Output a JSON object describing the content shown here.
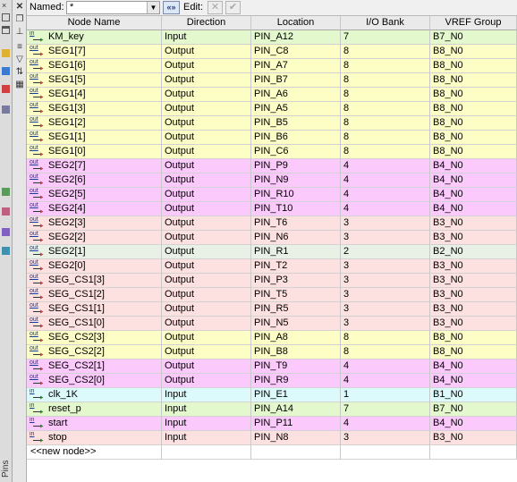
{
  "toolbar": {
    "named_label": "Named:",
    "named_value": "*",
    "expand_label": "«»",
    "edit_label": "Edit:",
    "cancel_glyph": "✕",
    "apply_glyph": "✔"
  },
  "side_tab": {
    "label": "Pins"
  },
  "table": {
    "columns": [
      "Node Name",
      "Direction",
      "Location",
      "I/O Bank",
      "VREF Group"
    ],
    "new_node_label": "<<new node>>",
    "rows": [
      {
        "name": "KM_key",
        "dir": "Input",
        "loc": "PIN_A12",
        "bank": "7",
        "vref": "B7_N0",
        "color": "green"
      },
      {
        "name": "SEG1[7]",
        "dir": "Output",
        "loc": "PIN_C8",
        "bank": "8",
        "vref": "B8_N0",
        "color": "yellow"
      },
      {
        "name": "SEG1[6]",
        "dir": "Output",
        "loc": "PIN_A7",
        "bank": "8",
        "vref": "B8_N0",
        "color": "yellow"
      },
      {
        "name": "SEG1[5]",
        "dir": "Output",
        "loc": "PIN_B7",
        "bank": "8",
        "vref": "B8_N0",
        "color": "yellow"
      },
      {
        "name": "SEG1[4]",
        "dir": "Output",
        "loc": "PIN_A6",
        "bank": "8",
        "vref": "B8_N0",
        "color": "yellow"
      },
      {
        "name": "SEG1[3]",
        "dir": "Output",
        "loc": "PIN_A5",
        "bank": "8",
        "vref": "B8_N0",
        "color": "yellow"
      },
      {
        "name": "SEG1[2]",
        "dir": "Output",
        "loc": "PIN_B5",
        "bank": "8",
        "vref": "B8_N0",
        "color": "yellow"
      },
      {
        "name": "SEG1[1]",
        "dir": "Output",
        "loc": "PIN_B6",
        "bank": "8",
        "vref": "B8_N0",
        "color": "yellow"
      },
      {
        "name": "SEG1[0]",
        "dir": "Output",
        "loc": "PIN_C6",
        "bank": "8",
        "vref": "B8_N0",
        "color": "yellow"
      },
      {
        "name": "SEG2[7]",
        "dir": "Output",
        "loc": "PIN_P9",
        "bank": "4",
        "vref": "B4_N0",
        "color": "magenta"
      },
      {
        "name": "SEG2[6]",
        "dir": "Output",
        "loc": "PIN_N9",
        "bank": "4",
        "vref": "B4_N0",
        "color": "magenta"
      },
      {
        "name": "SEG2[5]",
        "dir": "Output",
        "loc": "PIN_R10",
        "bank": "4",
        "vref": "B4_N0",
        "color": "magenta"
      },
      {
        "name": "SEG2[4]",
        "dir": "Output",
        "loc": "PIN_T10",
        "bank": "4",
        "vref": "B4_N0",
        "color": "magenta"
      },
      {
        "name": "SEG2[3]",
        "dir": "Output",
        "loc": "PIN_T6",
        "bank": "3",
        "vref": "B3_N0",
        "color": "pink"
      },
      {
        "name": "SEG2[2]",
        "dir": "Output",
        "loc": "PIN_N6",
        "bank": "3",
        "vref": "B3_N0",
        "color": "pink"
      },
      {
        "name": "SEG2[1]",
        "dir": "Output",
        "loc": "PIN_R1",
        "bank": "2",
        "vref": "B2_N0",
        "color": "gray"
      },
      {
        "name": "SEG2[0]",
        "dir": "Output",
        "loc": "PIN_T2",
        "bank": "3",
        "vref": "B3_N0",
        "color": "pink"
      },
      {
        "name": "SEG_CS1[3]",
        "dir": "Output",
        "loc": "PIN_P3",
        "bank": "3",
        "vref": "B3_N0",
        "color": "pink"
      },
      {
        "name": "SEG_CS1[2]",
        "dir": "Output",
        "loc": "PIN_T5",
        "bank": "3",
        "vref": "B3_N0",
        "color": "pink"
      },
      {
        "name": "SEG_CS1[1]",
        "dir": "Output",
        "loc": "PIN_R5",
        "bank": "3",
        "vref": "B3_N0",
        "color": "pink"
      },
      {
        "name": "SEG_CS1[0]",
        "dir": "Output",
        "loc": "PIN_N5",
        "bank": "3",
        "vref": "B3_N0",
        "color": "pink"
      },
      {
        "name": "SEG_CS2[3]",
        "dir": "Output",
        "loc": "PIN_A8",
        "bank": "8",
        "vref": "B8_N0",
        "color": "yellow"
      },
      {
        "name": "SEG_CS2[2]",
        "dir": "Output",
        "loc": "PIN_B8",
        "bank": "8",
        "vref": "B8_N0",
        "color": "yellow"
      },
      {
        "name": "SEG_CS2[1]",
        "dir": "Output",
        "loc": "PIN_T9",
        "bank": "4",
        "vref": "B4_N0",
        "color": "magenta"
      },
      {
        "name": "SEG_CS2[0]",
        "dir": "Output",
        "loc": "PIN_R9",
        "bank": "4",
        "vref": "B4_N0",
        "color": "magenta"
      },
      {
        "name": "clk_1K",
        "dir": "Input",
        "loc": "PIN_E1",
        "bank": "1",
        "vref": "B1_N0",
        "color": "cyan"
      },
      {
        "name": "reset_p",
        "dir": "Input",
        "loc": "PIN_A14",
        "bank": "7",
        "vref": "B7_N0",
        "color": "green"
      },
      {
        "name": "start",
        "dir": "Input",
        "loc": "PIN_P11",
        "bank": "4",
        "vref": "B4_N0",
        "color": "magenta"
      },
      {
        "name": "stop",
        "dir": "Input",
        "loc": "PIN_N8",
        "bank": "3",
        "vref": "B3_N0",
        "color": "pink"
      }
    ],
    "colors": {
      "yellow": "#fdfdc6",
      "green": "#e3f9cd",
      "magenta": "#fbc9fb",
      "pink": "#fde0e0",
      "gray": "#e9f0e6",
      "cyan": "#dcfafc"
    }
  }
}
